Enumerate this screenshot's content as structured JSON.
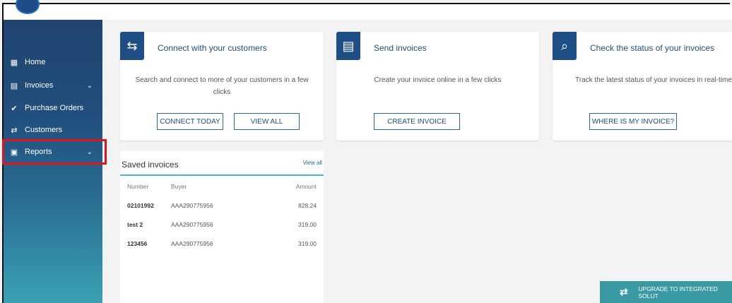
{
  "sidebar": {
    "items": [
      {
        "label": "Home",
        "icon": "grid-icon",
        "glyph": "▦",
        "chevron": false
      },
      {
        "label": "Invoices",
        "icon": "invoice-icon",
        "glyph": "▤",
        "chevron": true
      },
      {
        "label": "Purchase Orders",
        "icon": "check-circle-icon",
        "glyph": "✔",
        "chevron": false
      },
      {
        "label": "Customers",
        "icon": "handshake-icon",
        "glyph": "⇄",
        "chevron": false
      },
      {
        "label": "Reports",
        "icon": "report-icon",
        "glyph": "▣",
        "chevron": true
      }
    ],
    "chevron_glyph": "⌄"
  },
  "cards": [
    {
      "title": "Connect with your customers",
      "desc": "Search and connect to more of your customers in a few clicks",
      "glyph": "⇆",
      "buttons": [
        "CONNECT TODAY",
        "VIEW ALL"
      ]
    },
    {
      "title": "Send invoices",
      "desc": "Create your invoice online in a few clicks",
      "glyph": "▤",
      "buttons": [
        "CREATE INVOICE"
      ]
    },
    {
      "title": "Check the status of your invoices",
      "desc": "Track the latest status of your invoices in real-time",
      "glyph": "⌕",
      "buttons": [
        "WHERE IS MY INVOICE?"
      ]
    }
  ],
  "saved_invoices": {
    "title": "Saved invoices",
    "view_all": "View all",
    "columns": [
      "Number",
      "Buyer",
      "Amount"
    ],
    "rows": [
      {
        "number": "02101992",
        "buyer": "AAA290775956",
        "amount": "828.24"
      },
      {
        "number": "test 2",
        "buyer": "AAA290775956",
        "amount": "319.00"
      },
      {
        "number": "123456",
        "buyer": "AAA290775956",
        "amount": "319.00"
      }
    ]
  },
  "upgrade": {
    "label": "UPGRADE TO INTEGRATED SOLUT",
    "glyph": "⇄"
  },
  "colors": {
    "primary": "#1f4e87",
    "accent": "#4bb6c4",
    "highlight": "#e0141d"
  }
}
